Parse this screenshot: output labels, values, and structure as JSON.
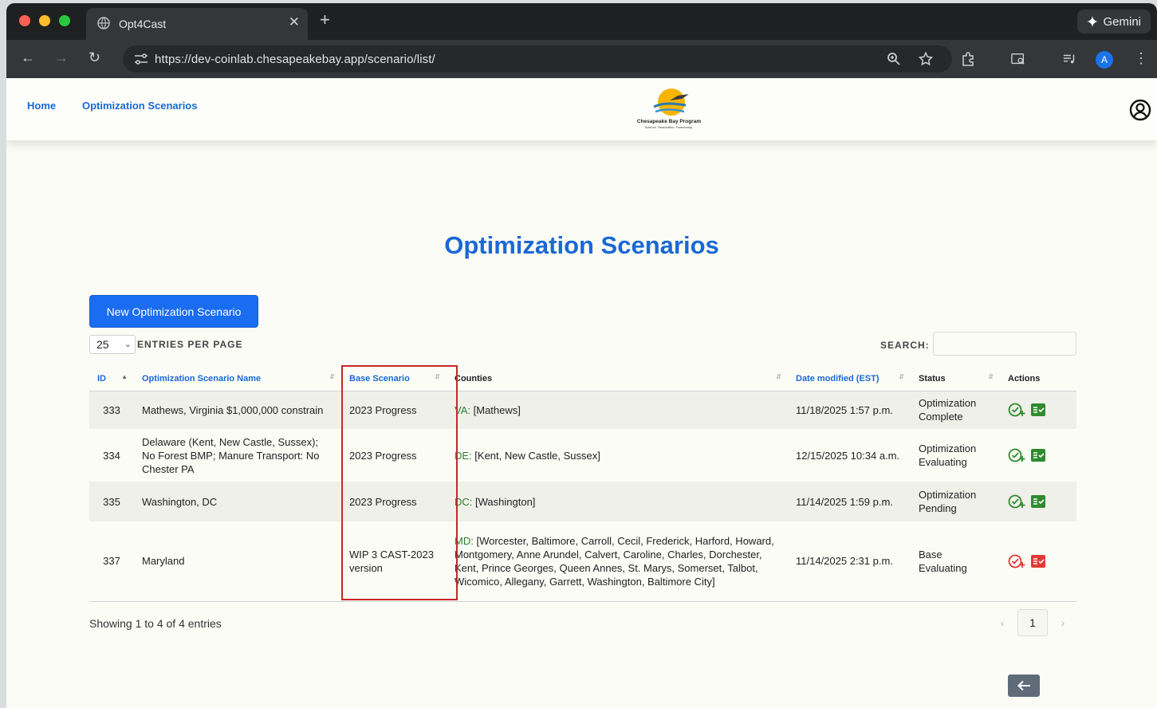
{
  "browser": {
    "tab_title": "Opt4Cast",
    "tab_close": "✕",
    "new_tab": "+",
    "gemini_label": "Gemini",
    "url": "https://dev-coinlab.chesapeakebay.app/scenario/list/",
    "avatar_letter": "A",
    "traffic_light_colors": [
      "#fe5f57",
      "#febc2e",
      "#28c840"
    ]
  },
  "site_nav": {
    "home": "Home",
    "scenarios": "Optimization Scenarios",
    "logo_line1": "Chesapeake Bay Program",
    "logo_line2": "Science. Restoration. Partnership."
  },
  "page": {
    "title": "Optimization Scenarios",
    "new_button": "New Optimization Scenario",
    "entries_value": "25",
    "entries_label": "ENTRIES PER PAGE",
    "search_label": "SEARCH:",
    "search_value": ""
  },
  "table": {
    "headers": {
      "id": "ID",
      "name": "Optimization Scenario Name",
      "base": "Base Scenario",
      "counties": "Counties",
      "date": "Date modified (EST)",
      "status": "Status",
      "actions": "Actions"
    },
    "rows": [
      {
        "id": "333",
        "name": "Mathews, Virginia $1,000,000 constrain",
        "base": "2023 Progress",
        "state": "VA:",
        "counties": "[Mathews]",
        "date": "11/18/2025 1:57 p.m.",
        "status": "Optimization Complete",
        "action_color": "#2e8b2e"
      },
      {
        "id": "334",
        "name": "Delaware (Kent, New Castle, Sussex); No Forest BMP; Manure Transport: No Chester PA",
        "base": "2023 Progress",
        "state": "DE:",
        "counties": "[Kent, New Castle, Sussex]",
        "date": "12/15/2025 10:34 a.m.",
        "status": "Optimization Evaluating",
        "action_color": "#2e8b2e"
      },
      {
        "id": "335",
        "name": "Washington, DC",
        "base": "2023 Progress",
        "state": "DC:",
        "counties": "[Washington]",
        "date": "11/14/2025 1:59 p.m.",
        "status": "Optimization Pending",
        "action_color": "#2e8b2e"
      },
      {
        "id": "337",
        "name": "Maryland",
        "base": "WIP 3 CAST-2023 version",
        "state": "MD:",
        "counties": "[Worcester, Baltimore, Carroll, Cecil, Frederick, Harford, Howard, Montgomery, Anne Arundel, Calvert, Caroline, Charles, Dorchester, Kent, Prince Georges, Queen Annes, St. Marys, Somerset, Talbot, Wicomico, Allegany, Garrett, Washington, Baltimore City]",
        "date": "11/14/2025 2:31 p.m.",
        "status": "Base Evaluating",
        "action_color": "#e53935"
      }
    ]
  },
  "footer": {
    "info": "Showing 1 to 4 of 4 entries",
    "prev": "‹",
    "page": "1",
    "next": "›"
  },
  "colors": {
    "accent": "#1a68d6",
    "button": "#1a6cf0",
    "highlight": "#c9262c"
  }
}
